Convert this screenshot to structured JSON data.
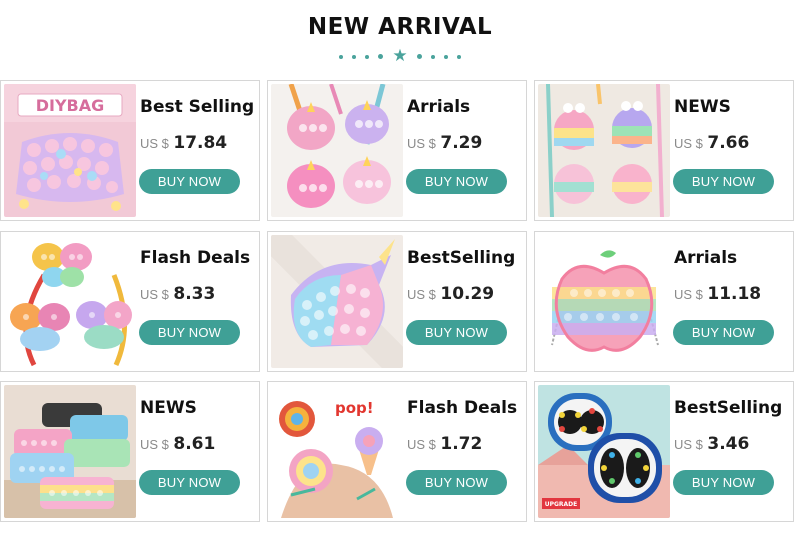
{
  "header": {
    "title": "NEW ARRIVAL"
  },
  "colors": {
    "accent": "#3fa096",
    "dots": "#4aa39c"
  },
  "products": [
    {
      "title": "Best Selling",
      "currency": "US $",
      "price": "17.84",
      "button": "BUY NOW",
      "image_icon": "diy-bag-popit-image",
      "image_text": "DIYBAG"
    },
    {
      "title": "Arrials",
      "currency": "US $",
      "price": "7.29",
      "button": "BUY NOW",
      "image_icon": "unicorn-popit-bags-image"
    },
    {
      "title": "NEWS",
      "currency": "US $",
      "price": "7.66",
      "button": "BUY NOW",
      "image_icon": "rainbow-popit-bags-image"
    },
    {
      "title": "Flash Deals",
      "currency": "US $",
      "price": "8.33",
      "button": "BUY NOW",
      "image_icon": "butterfly-popit-bags-image"
    },
    {
      "title": "BestSelling",
      "currency": "US $",
      "price": "10.29",
      "button": "BUY NOW",
      "image_icon": "unicorn-head-popit-image"
    },
    {
      "title": "Arrials",
      "currency": "US $",
      "price": "11.18",
      "button": "BUY NOW",
      "image_icon": "apple-popit-bag-image"
    },
    {
      "title": "NEWS",
      "currency": "US $",
      "price": "8.61",
      "button": "BUY NOW",
      "image_icon": "popit-pencil-cases-image"
    },
    {
      "title": "Flash Deals",
      "currency": "US $",
      "price": "1.72",
      "button": "BUY NOW",
      "image_icon": "popit-keychain-image",
      "image_text": "pop!"
    },
    {
      "title": "BestSelling",
      "currency": "US $",
      "price": "3.46",
      "button": "BUY NOW",
      "image_icon": "bead-spinner-toy-image",
      "image_text": "UPGRADE"
    }
  ]
}
